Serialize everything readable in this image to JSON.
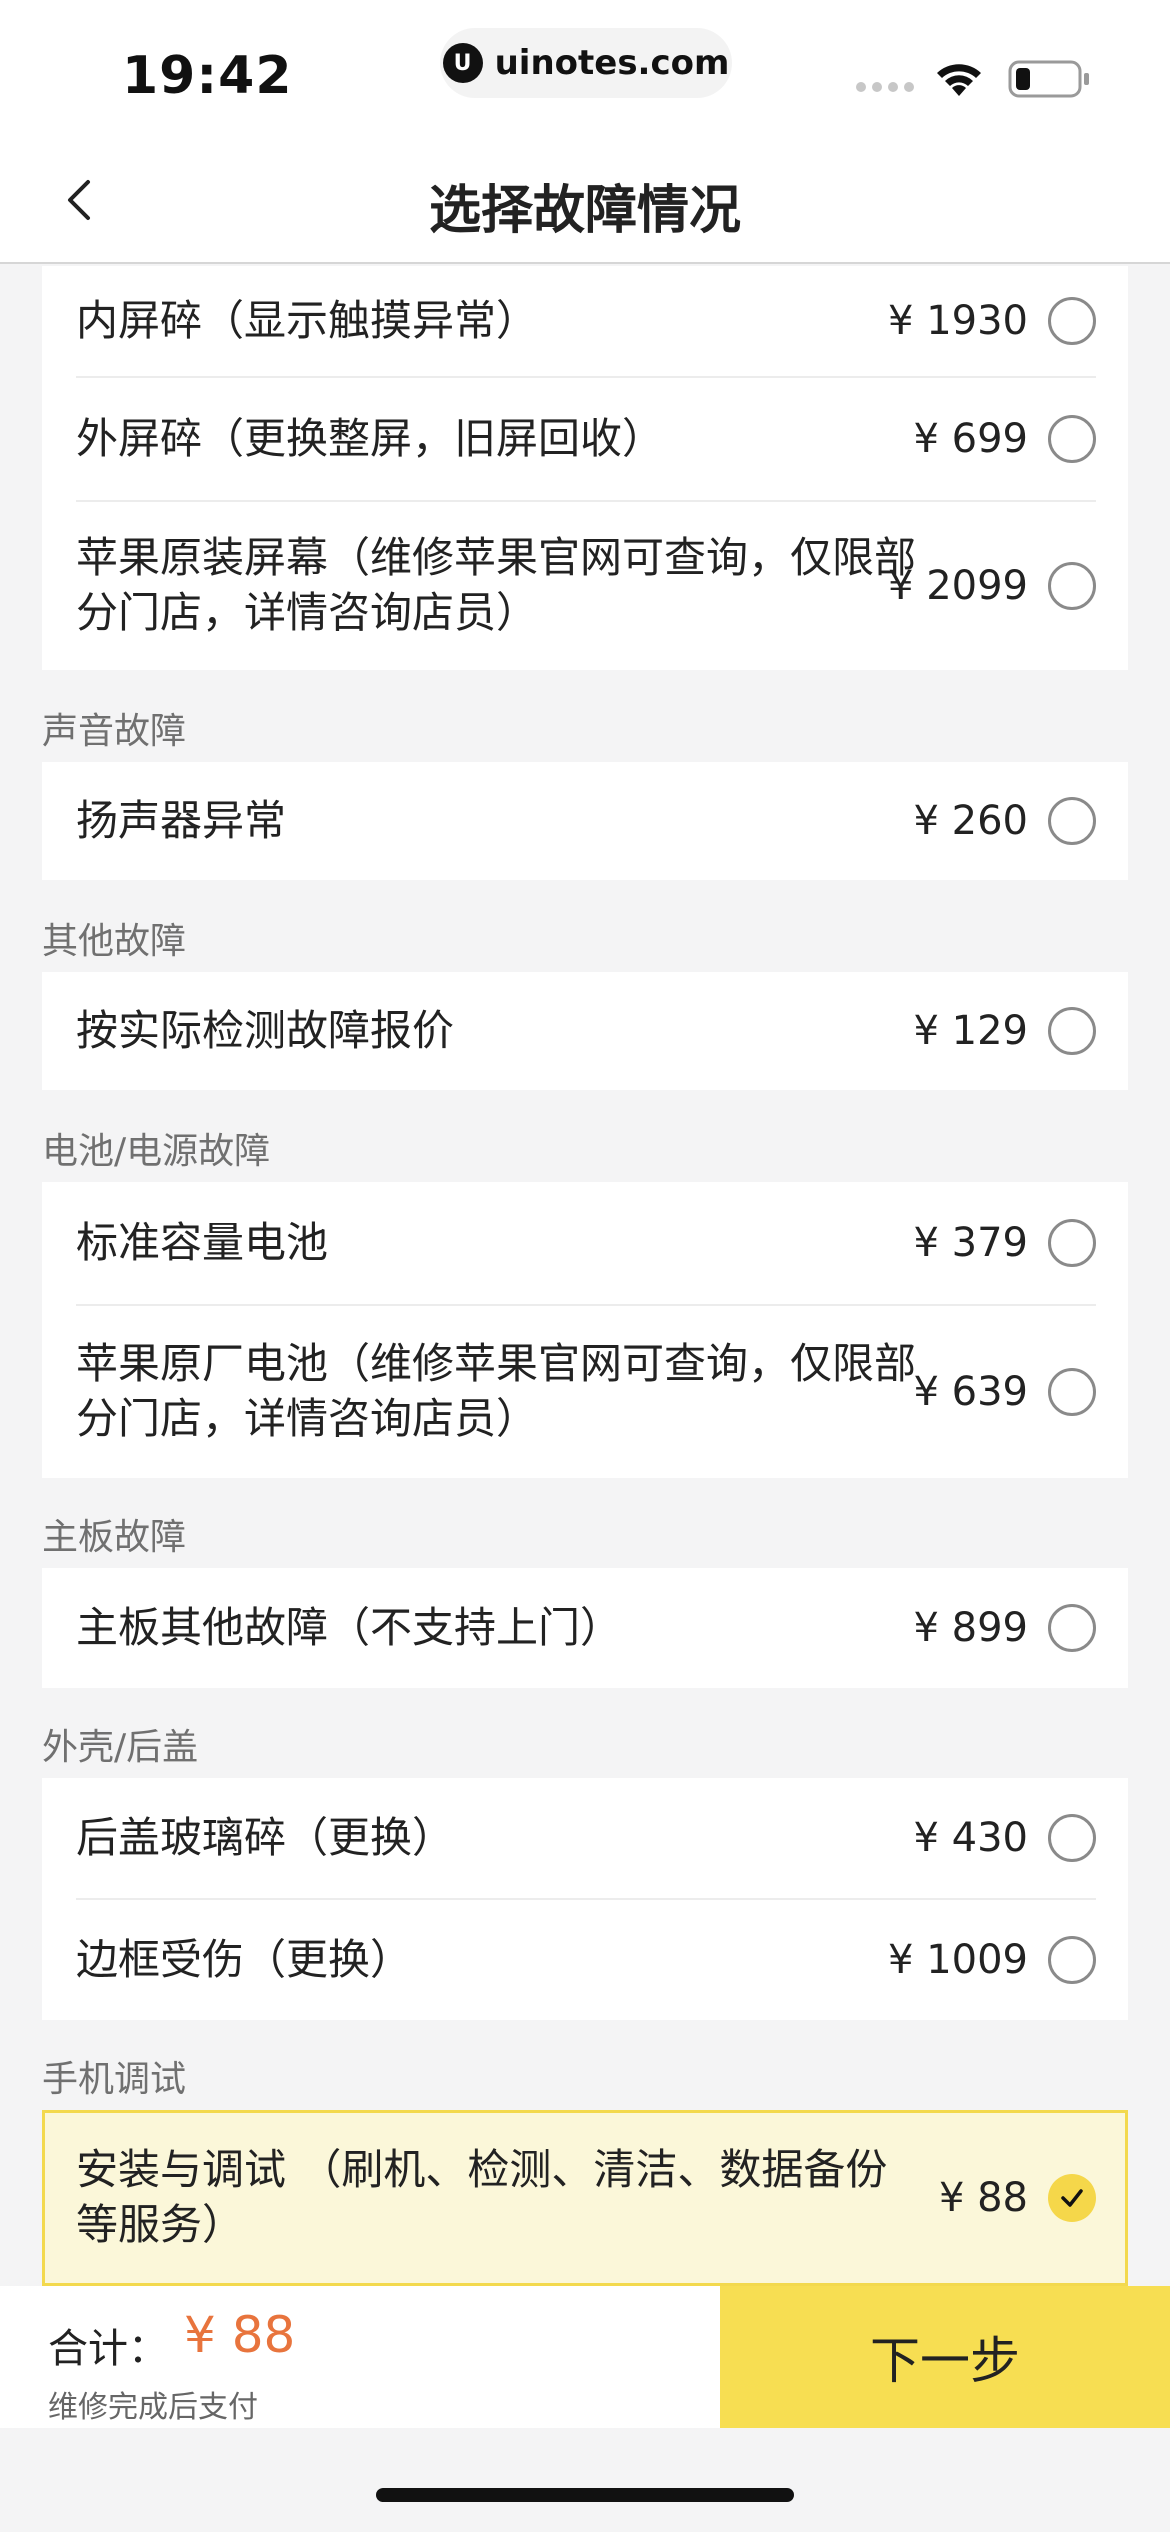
{
  "status_bar": {
    "time": "19:42",
    "url": "uinotes.com"
  },
  "nav": {
    "title": "选择故障情况"
  },
  "screen_card": {
    "items": [
      {
        "label": "内屏碎（显示触摸异常）",
        "price": "¥ 1930",
        "selected": false
      },
      {
        "label": "外屏碎（更换整屏，旧屏回收）",
        "price": "¥ 699",
        "selected": false
      },
      {
        "label": "苹果原装屏幕（维修苹果官网可查询，仅限部分门店，详情咨询店员）",
        "price": "¥ 2099",
        "selected": false
      }
    ]
  },
  "sections": [
    {
      "title": "声音故障",
      "items": [
        {
          "label": "扬声器异常",
          "price": "¥ 260",
          "selected": false
        }
      ]
    },
    {
      "title": "其他故障",
      "items": [
        {
          "label": "按实际检测故障报价",
          "price": "¥ 129",
          "selected": false
        }
      ]
    },
    {
      "title": "电池/电源故障",
      "items": [
        {
          "label": "标准容量电池",
          "price": "¥ 379",
          "selected": false
        },
        {
          "label": "苹果原厂电池（维修苹果官网可查询，仅限部分门店，详情咨询店员）",
          "price": "¥ 639",
          "selected": false
        }
      ]
    },
    {
      "title": "主板故障",
      "items": [
        {
          "label": "主板其他故障（不支持上门）",
          "price": "¥ 899",
          "selected": false
        }
      ]
    },
    {
      "title": "外壳/后盖",
      "items": [
        {
          "label": "后盖玻璃碎（更换）",
          "price": "¥ 430",
          "selected": false
        },
        {
          "label": "边框受伤（更换）",
          "price": "¥ 1009",
          "selected": false
        }
      ]
    },
    {
      "title": "手机调试",
      "items": [
        {
          "label": "安装与调试 （刷机、检测、清洁、数据备份等服务）",
          "price": "¥ 88",
          "selected": true
        }
      ]
    }
  ],
  "footer": {
    "total_label": "合计：",
    "total_amount": "¥ 88",
    "note": "维修完成后支付",
    "next_label": "下一步"
  },
  "colors": {
    "accent": "#f7de52",
    "price_total": "#e8743d",
    "selected_bg": "#fbf7d9"
  }
}
